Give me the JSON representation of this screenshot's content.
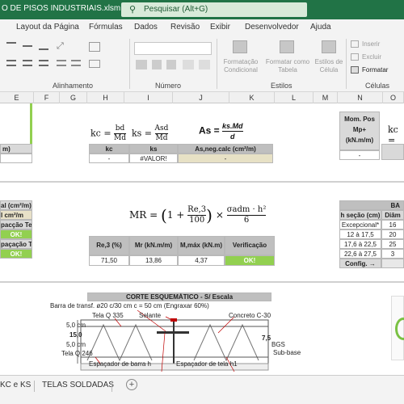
{
  "titlebar": {
    "title": "O DE PISOS INDUSTRIAIS.xlsm  -  Excel",
    "search_placeholder": "Pesquisar (Alt+G)"
  },
  "ribbon_tabs": [
    "Layout da Página",
    "Fórmulas",
    "Dados",
    "Revisão",
    "Exibir",
    "Desenvolvedor",
    "Ajuda"
  ],
  "ribbon": {
    "groups": {
      "alinhamento": "Alinhamento",
      "numero": "Número",
      "estilos": "Estilos",
      "celulas": "Células"
    },
    "estilos_buttons": [
      "Formatação Condicional",
      "Formatar como Tabela",
      "Estilos de Célula"
    ],
    "cell_buttons": {
      "inserir": "Inserir",
      "excluir": "Excluir",
      "formatar": "Formatar"
    }
  },
  "columns": [
    "E",
    "F",
    "G",
    "H",
    "I",
    "J",
    "K",
    "L",
    "M",
    "N",
    "O"
  ],
  "left_partial": {
    "row1": "m)",
    "r2_1": "al (cm²/m)",
    "r2_2": "l cm²/m",
    "r2_3": "pacção Tela",
    "r2_4": "OK!",
    "r2_5": "paçação Tela",
    "r2_6": "OK!"
  },
  "kc_table": {
    "formula_kc": "kc =",
    "formula_kc_num": "bd",
    "formula_kc_den": "Md",
    "formula_ks": "ks =",
    "formula_ks_num": "Asd",
    "formula_ks_den": "Md",
    "formula_as": "As =",
    "formula_as_num": "ks.Md",
    "formula_as_den": "d",
    "headers": [
      "kc",
      "ks",
      "As,neg.calc (cm²/m)"
    ],
    "values": [
      "-",
      "#VALOR!",
      "-"
    ]
  },
  "mom_table": {
    "header_lines": [
      "Mom. Pos",
      "Mp+",
      "(kN.m/m)"
    ],
    "value": "-",
    "formula_kc": "kc ="
  },
  "mr_table": {
    "formula_lhs": "MR = ",
    "formula_frac_num": "Re,3",
    "formula_frac_den": "100",
    "formula_sig_num": "σadm · h²",
    "formula_sig_den": "6",
    "formula_one": "1 +",
    "formula_times": "×",
    "headers": [
      "Re,3 (%)",
      "Mr (kN.m/m)",
      "M,máx (kN.m)",
      "Verificação"
    ],
    "values": [
      "71,50",
      "13,86",
      "4,37",
      "OK!"
    ]
  },
  "tela_table": {
    "title": "BA",
    "headers": [
      "h seção (cm)",
      "Diâm"
    ],
    "rows": [
      [
        "Excepcional*",
        "16"
      ],
      [
        "12 à 17,5",
        "20"
      ],
      [
        "17,6 à 22,5",
        "25"
      ],
      [
        "22,6 à 27,5",
        "3"
      ]
    ],
    "config": "Config. →"
  },
  "corte": {
    "title": "CORTE ESQUEMÁTICO - S/ Escala",
    "labels": {
      "barra": "Barra de transf. ø20 c/30 cm c = 50 cm (Engraxar 60%)",
      "tela_q335": "Tela Q 335",
      "selante": "Selante",
      "concreto": "Concreto C-30",
      "dim_top": "5,0 cm",
      "dim_bot": "5,0 cm",
      "dim_15": "15,0",
      "tela_q246": "Tela Q 246",
      "bgs": "BGS",
      "subbase": "Sub-base",
      "esp_barra": "Espaçador de barra h",
      "esp_tela": "Espaçador de tela h1",
      "dim_75": "7,5"
    }
  },
  "sheet_tabs": [
    "KC e KS",
    "TELAS SOLDADAS"
  ],
  "add_sheet": "+",
  "colors": {
    "excel_green": "#217346",
    "ok_green": "#92d050",
    "header_gray": "#bfbfbf"
  }
}
